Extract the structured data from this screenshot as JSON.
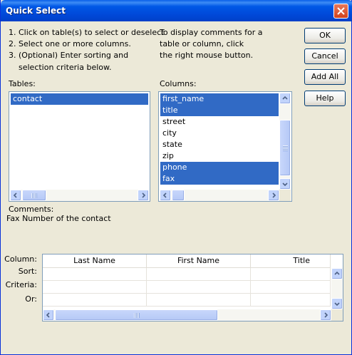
{
  "window": {
    "title": "Quick Select"
  },
  "instructions": {
    "step1": "1. Click on table(s) to select or deselect",
    "step2": "2. Select one or more columns.",
    "step3a": "3. (Optional) Enter sorting and",
    "step3b": "selection criteria below.",
    "hint1": "To display comments for a",
    "hint2": "table or column, click",
    "hint3": "the right mouse button."
  },
  "buttons": {
    "ok": "OK",
    "cancel": "Cancel",
    "add_all": "Add All",
    "help": "Help"
  },
  "tables": {
    "label": "Tables:",
    "items": [
      {
        "name": "contact",
        "selected": true
      }
    ]
  },
  "columns": {
    "label": "Columns:",
    "items": [
      {
        "name": "first_name",
        "selected": true
      },
      {
        "name": "title",
        "selected": true
      },
      {
        "name": "street",
        "selected": false
      },
      {
        "name": "city",
        "selected": false
      },
      {
        "name": "state",
        "selected": false
      },
      {
        "name": "zip",
        "selected": false
      },
      {
        "name": "phone",
        "selected": true
      },
      {
        "name": "fax",
        "selected": true
      }
    ]
  },
  "comments": {
    "label": "Comments:",
    "text": "Fax Number of the contact"
  },
  "criteria_grid": {
    "row_labels": [
      "Column:",
      "Sort:",
      "Criteria:",
      "Or:"
    ],
    "columns": [
      "Last Name",
      "First Name",
      "Title"
    ]
  },
  "colors": {
    "selection": "#316ac5",
    "titlebar": "#0058e6",
    "dialog_bg": "#ece9d8"
  },
  "icons": {
    "close": "close-x-icon",
    "arrow_up": "arrow-up-icon",
    "arrow_down": "arrow-down-icon",
    "arrow_left": "arrow-left-icon",
    "arrow_right": "arrow-right-icon"
  }
}
